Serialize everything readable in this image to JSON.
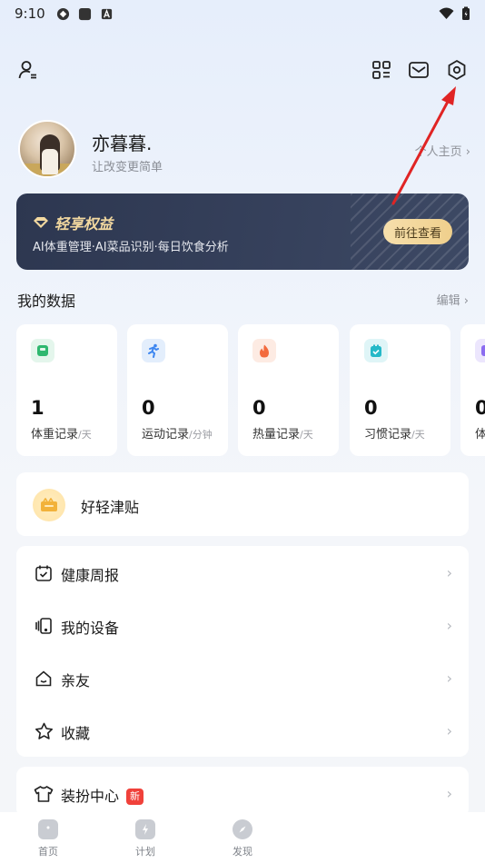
{
  "status": {
    "time": "9:10"
  },
  "profile": {
    "name": "亦暮暮.",
    "subtitle": "让改变更简单",
    "home_link": "个人主页 ›"
  },
  "vip": {
    "title": "轻享权益",
    "desc": "AI体重管理·AI菜品识别·每日饮食分析",
    "button": "前往查看"
  },
  "my_data": {
    "title": "我的数据",
    "edit": "编辑 ›",
    "cards": [
      {
        "value": "1",
        "label": "体重记录",
        "unit": "/天",
        "icon": "scale-icon",
        "color": "#2fb86f"
      },
      {
        "value": "0",
        "label": "运动记录",
        "unit": "/分钟",
        "icon": "running-icon",
        "color": "#3d86f0"
      },
      {
        "value": "0",
        "label": "热量记录",
        "unit": "/天",
        "icon": "flame-icon",
        "color": "#f36a3d"
      },
      {
        "value": "0",
        "label": "习惯记录",
        "unit": "/天",
        "icon": "habit-icon",
        "color": "#25b9c8"
      },
      {
        "value": "0",
        "label": "体",
        "unit": "",
        "icon": "purple-icon",
        "color": "#8b6cf0"
      }
    ]
  },
  "subsidy": {
    "label": "好轻津贴"
  },
  "menu": {
    "items": [
      {
        "label": "健康周报",
        "icon": "calendar-icon"
      },
      {
        "label": "我的设备",
        "icon": "device-icon"
      },
      {
        "label": "亲友",
        "icon": "home-icon"
      },
      {
        "label": "收藏",
        "icon": "star-icon"
      }
    ]
  },
  "dress": {
    "label": "装扮中心",
    "tag": "新"
  },
  "tabs": [
    {
      "label": "首页",
      "icon": "home-tab-icon"
    },
    {
      "label": "计划",
      "icon": "plan-tab-icon"
    },
    {
      "label": "发现",
      "icon": "compass-tab-icon"
    }
  ],
  "colors": {
    "annotation_arrow": "#e02424",
    "vip_gold": "#f3d9a0",
    "new_tag": "#f0413a"
  }
}
